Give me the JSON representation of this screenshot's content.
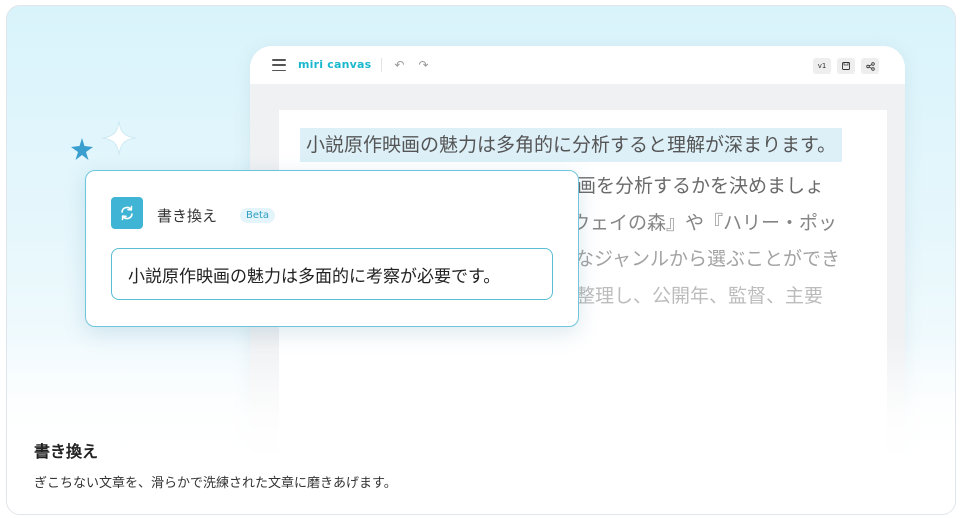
{
  "app": {
    "logo_text": "miri canvas",
    "undo_icon": "undo-icon",
    "redo_icon": "redo-icon",
    "version_label": "v1",
    "toolbar_right_icons": [
      "save-icon",
      "share-icon"
    ],
    "accent_color": "#1ab8cf"
  },
  "document": {
    "lines": [
      "小説原作映画の魅力は多角的に分析すると理解が深まります。",
      "画を分析するかを決めましょ",
      "ウェイの森』や『ハリー・ポッ",
      "なジャンルから選ぶことができ",
      "整理し、公開年、監督、主要",
      ""
    ]
  },
  "popover": {
    "title": "書き換え",
    "badge": "Beta",
    "icon": "rewrite-icon",
    "field_value": "小説原作映画の魅力は多面的に考察が必要です。"
  },
  "caption": {
    "title": "書き換え",
    "description": "ぎこちない文章を、滑らかで洗練された文章に磨きあげます。"
  }
}
